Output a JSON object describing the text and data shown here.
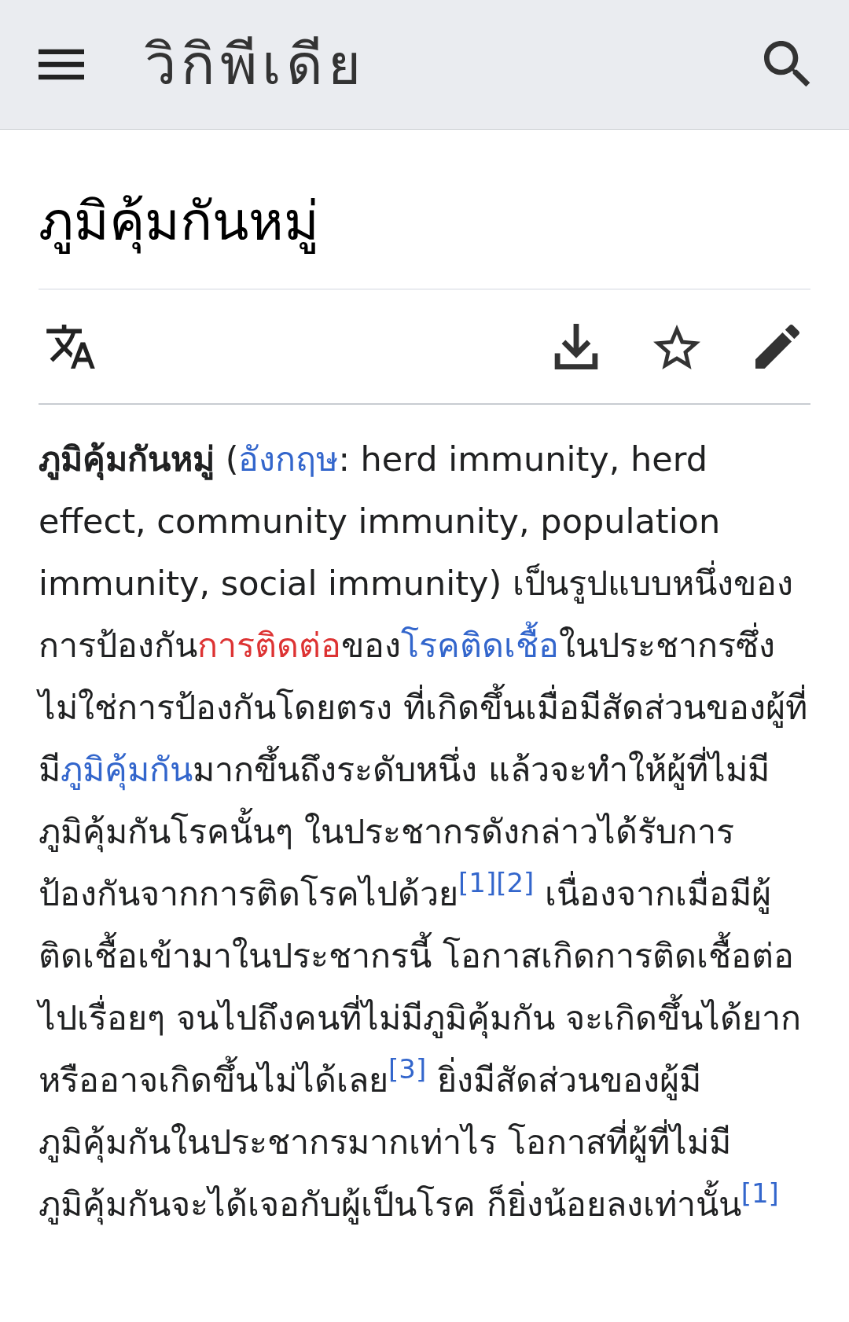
{
  "header": {
    "wordmark": "วิกิพีเดีย"
  },
  "article": {
    "title": "ภูมิคุ้มกันหมู่",
    "paragraph": [
      {
        "kind": "bold",
        "text": "ภูมิคุ้มกันหมู่"
      },
      {
        "kind": "text",
        "text": " ("
      },
      {
        "kind": "link",
        "text": "อังกฤษ"
      },
      {
        "kind": "text",
        "text": ": herd immunity, herd effect, community immunity, population immunity, social immunity) เป็นรูปแบบหนึ่งของการป้องกัน"
      },
      {
        "kind": "redlink",
        "text": "การติดต่อ"
      },
      {
        "kind": "text",
        "text": "ของ"
      },
      {
        "kind": "link",
        "text": "โรคติดเชื้อ"
      },
      {
        "kind": "text",
        "text": "ในประชากรซึ่งไม่ใช่การป้องกันโดยตรง ที่เกิดขึ้นเมื่อมีสัดส่วนของผู้ที่มี"
      },
      {
        "kind": "link",
        "text": "ภูมิคุ้มกัน"
      },
      {
        "kind": "text",
        "text": "มากขึ้นถึงระดับหนึ่ง แล้วจะทำให้ผู้ที่ไม่มีภูมิคุ้มกันโรคนั้นๆ ในประชากรดังกล่าวได้รับการป้องกันจากการติดโรคไปด้วย"
      },
      {
        "kind": "ref",
        "text": "[1]"
      },
      {
        "kind": "ref",
        "text": "[2]"
      },
      {
        "kind": "text",
        "text": " เนื่องจากเมื่อมีผู้ติดเชื้อเข้ามาในประชากรนี้ โอกาสเกิดการติดเชื้อต่อไปเรื่อยๆ จนไปถึงคนที่ไม่มีภูมิคุ้มกัน จะเกิดขึ้นได้ยาก หรืออาจเกิดขึ้นไม่ได้เลย"
      },
      {
        "kind": "ref",
        "text": "[3]"
      },
      {
        "kind": "text",
        "text": " ยิ่งมีสัดส่วนของผู้มีภูมิคุ้มกันในประชากรมากเท่าไร โอกาสที่ผู้ที่ไม่มีภูมิคุ้มกันจะได้เจอกับผู้เป็นโรค ก็ยิ่งน้อยลงเท่านั้น"
      },
      {
        "kind": "ref",
        "text": "[1]"
      }
    ]
  }
}
